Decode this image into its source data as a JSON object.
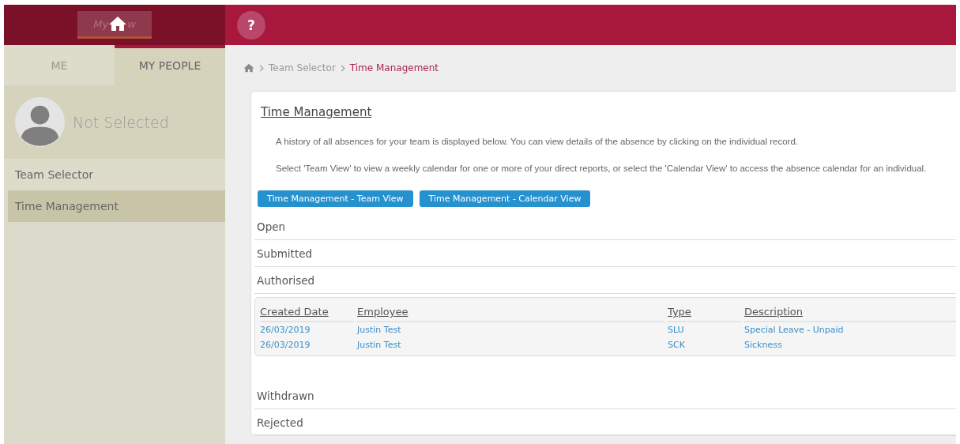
{
  "sidebar": {
    "logo_parts": [
      "My",
      "w"
    ],
    "tabs": [
      {
        "label": "ME",
        "selected": false
      },
      {
        "label": "MY PEOPLE",
        "selected": true
      }
    ],
    "profile": {
      "name": "Not Selected"
    },
    "items": [
      {
        "label": "Team Selector",
        "selected": false
      },
      {
        "label": "Time Management",
        "selected": true
      }
    ]
  },
  "header": {
    "help_label": "?"
  },
  "breadcrumb": [
    {
      "label": "Team Selector",
      "current": false
    },
    {
      "label": "Time Management",
      "current": true
    }
  ],
  "card": {
    "title": "Time Management",
    "paragraphs": [
      "A history of all absences for your team is displayed below. You can view details of the absence by clicking on the individual record.",
      "Select 'Team View' to view a weekly calendar for one or more of your direct reports, or select the 'Calendar View' to access the absence calendar for an individual."
    ],
    "buttons": [
      "Time Management - Team View",
      "Time Management - Calendar View"
    ],
    "sections": [
      {
        "title": "Open"
      },
      {
        "title": "Submitted"
      },
      {
        "title": "Authorised",
        "table": {
          "columns": [
            "Created Date",
            "Employee",
            "Type",
            "Description"
          ],
          "rows": [
            [
              "26/03/2019",
              "Justin Test",
              "SLU",
              "Special Leave - Unpaid"
            ],
            [
              "26/03/2019",
              "Justin Test",
              "SCK",
              "Sickness"
            ]
          ]
        }
      },
      {
        "title": "Withdrawn"
      },
      {
        "title": "Rejected"
      }
    ]
  }
}
